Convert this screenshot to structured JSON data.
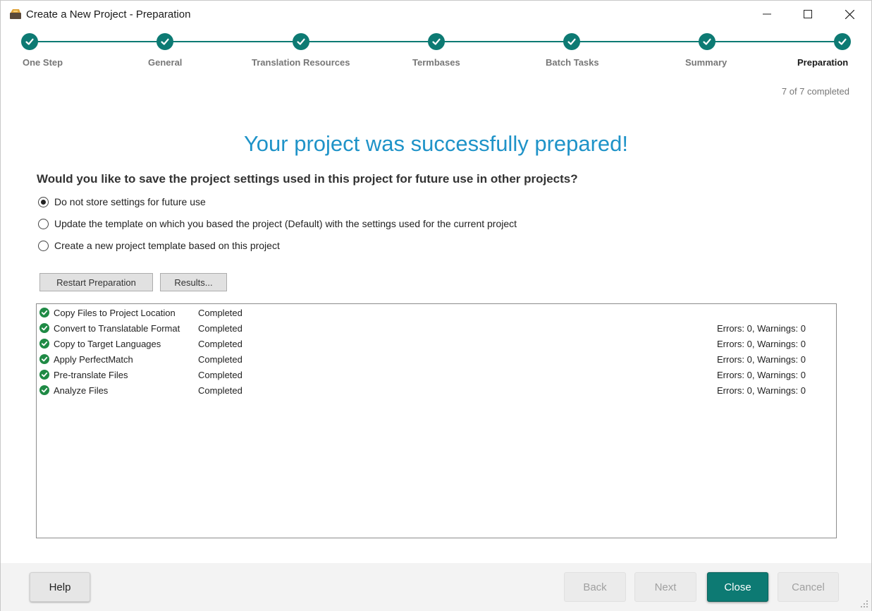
{
  "window": {
    "title": "Create a New Project - Preparation"
  },
  "stepper": {
    "steps": [
      {
        "label": "One Step",
        "done": true
      },
      {
        "label": "General",
        "done": true
      },
      {
        "label": "Translation Resources",
        "done": true
      },
      {
        "label": "Termbases",
        "done": true
      },
      {
        "label": "Batch Tasks",
        "done": true
      },
      {
        "label": "Summary",
        "done": true
      },
      {
        "label": "Preparation",
        "done": true,
        "active": true
      }
    ],
    "progress_text": "7 of 7 completed"
  },
  "main": {
    "headline": "Your project was successfully prepared!",
    "question": "Would you like to save the project settings used in this project for future use in other projects?",
    "options": [
      {
        "label": "Do not store settings for future use",
        "checked": true
      },
      {
        "label": "Update the template on which you based the project (Default) with the settings used for the current project",
        "checked": false
      },
      {
        "label": "Create a new project template based on this project",
        "checked": false
      }
    ],
    "restart_label": "Restart Preparation",
    "results_label": "Results..."
  },
  "tasks": [
    {
      "name": "Copy Files to Project Location",
      "status": "Completed",
      "result": ""
    },
    {
      "name": "Convert to Translatable Format",
      "status": "Completed",
      "result": "Errors: 0, Warnings: 0"
    },
    {
      "name": "Copy to Target Languages",
      "status": "Completed",
      "result": "Errors: 0, Warnings: 0"
    },
    {
      "name": "Apply PerfectMatch",
      "status": "Completed",
      "result": "Errors: 0, Warnings: 0"
    },
    {
      "name": "Pre-translate Files",
      "status": "Completed",
      "result": "Errors: 0, Warnings: 0"
    },
    {
      "name": "Analyze Files",
      "status": "Completed",
      "result": "Errors: 0, Warnings: 0"
    }
  ],
  "footer": {
    "help_label": "Help",
    "back_label": "Back",
    "next_label": "Next",
    "close_label": "Close",
    "cancel_label": "Cancel"
  },
  "colors": {
    "accent": "#0d7a73",
    "headline": "#1f93c8",
    "success": "#1f8a45"
  }
}
